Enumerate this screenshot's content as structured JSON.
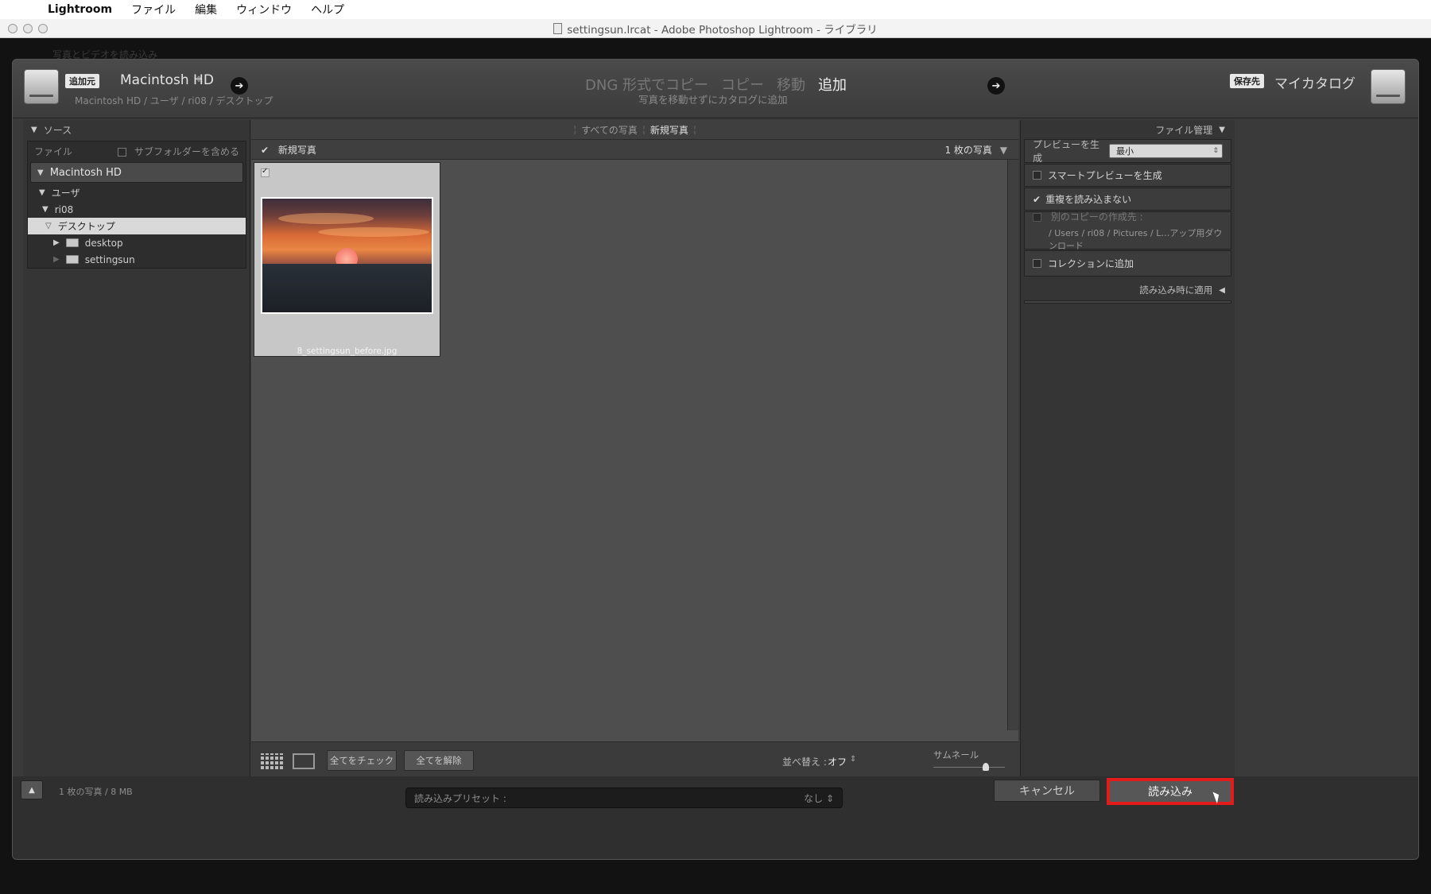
{
  "menubar": {
    "apple": "",
    "app": "Lightroom",
    "items": [
      "ファイル",
      "編集",
      "ウィンドウ",
      "ヘルプ"
    ]
  },
  "window": {
    "title": "settingsun.lrcat - Adobe Photoshop Lightroom - ライブラリ"
  },
  "background": {
    "ghost_text": "写真とビデオを読み込み"
  },
  "header": {
    "source_tag": "追加元",
    "source_name": "Macintosh HD",
    "source_path": "Macintosh HD / ユーザ / ri08 / デスクトップ",
    "modes": [
      "DNG 形式でコピー",
      "コピー",
      "移動",
      "追加"
    ],
    "active_mode": "追加",
    "mode_subtitle": "写真を移動せずにカタログに追加",
    "dest_tag": "保存先",
    "dest_name": "マイカタログ"
  },
  "source_panel": {
    "title": "ソース",
    "files_label": "ファイル",
    "subfolder_label": "サブフォルダーを含める",
    "volume": "Macintosh HD",
    "tree": [
      {
        "label": "ユーザ"
      },
      {
        "label": "ri08"
      },
      {
        "label": "デスクトップ"
      },
      {
        "label": "desktop"
      },
      {
        "label": "settingsun"
      }
    ]
  },
  "grid": {
    "tabs": [
      "すべての写真",
      "新規写真"
    ],
    "active_tab": "新規写真",
    "section_label": "新規写真",
    "count": "1 枚の写真",
    "photo_filename": "8_settingsun_before.jpg",
    "check_all": "全てをチェック",
    "uncheck_all": "全てを解除",
    "sort_label": "並べ替え :",
    "sort_value": "オフ",
    "thumb_label": "サムネール"
  },
  "file_panel": {
    "title": "ファイル管理",
    "preview_label": "プレビューを生成",
    "preview_value": "最小",
    "smart_preview": "スマートプレビューを生成",
    "no_duplicates": "重複を読み込まない",
    "second_copy": "別のコピーの作成先 :",
    "second_copy_path": "/ Users / ri08 / Pictures / L…アップ用ダウンロード",
    "add_collection": "コレクションに追加",
    "apply_during_import": "読み込み時に適用"
  },
  "footer": {
    "summary": "1 枚の写真 / 8 MB",
    "preset_label": "読み込みプリセット :",
    "preset_value": "なし",
    "cancel": "キャンセル",
    "import": "読み込み"
  },
  "colors": {
    "highlight": "#e31b1b"
  }
}
